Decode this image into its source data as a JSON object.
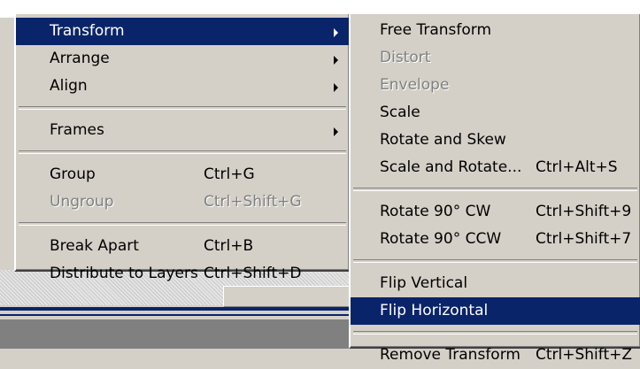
{
  "main_menu": {
    "items": [
      {
        "label": "Transform",
        "shortcut": "",
        "submenu": true,
        "highlighted": true,
        "disabled": false
      },
      {
        "label": "Arrange",
        "shortcut": "",
        "submenu": true,
        "highlighted": false,
        "disabled": false
      },
      {
        "label": "Align",
        "shortcut": "",
        "submenu": true,
        "highlighted": false,
        "disabled": false
      },
      {
        "label": "Frames",
        "shortcut": "",
        "submenu": true,
        "highlighted": false,
        "disabled": false
      },
      {
        "label": "Group",
        "shortcut": "Ctrl+G",
        "submenu": false,
        "highlighted": false,
        "disabled": false
      },
      {
        "label": "Ungroup",
        "shortcut": "Ctrl+Shift+G",
        "submenu": false,
        "highlighted": false,
        "disabled": true
      },
      {
        "label": "Break Apart",
        "shortcut": "Ctrl+B",
        "submenu": false,
        "highlighted": false,
        "disabled": false
      },
      {
        "label": "Distribute to Layers",
        "shortcut": "Ctrl+Shift+D",
        "submenu": false,
        "highlighted": false,
        "disabled": false
      }
    ]
  },
  "transform_submenu": {
    "items": [
      {
        "label": "Free Transform",
        "shortcut": "",
        "disabled": false,
        "highlighted": false
      },
      {
        "label": "Distort",
        "shortcut": "",
        "disabled": true,
        "highlighted": false
      },
      {
        "label": "Envelope",
        "shortcut": "",
        "disabled": true,
        "highlighted": false
      },
      {
        "label": "Scale",
        "shortcut": "",
        "disabled": false,
        "highlighted": false
      },
      {
        "label": "Rotate and Skew",
        "shortcut": "",
        "disabled": false,
        "highlighted": false
      },
      {
        "label": "Scale and Rotate...",
        "shortcut": "Ctrl+Alt+S",
        "disabled": false,
        "highlighted": false
      },
      {
        "label": "Rotate 90° CW",
        "shortcut": "Ctrl+Shift+9",
        "disabled": false,
        "highlighted": false
      },
      {
        "label": "Rotate 90° CCW",
        "shortcut": "Ctrl+Shift+7",
        "disabled": false,
        "highlighted": false
      },
      {
        "label": "Flip Vertical",
        "shortcut": "",
        "disabled": false,
        "highlighted": false
      },
      {
        "label": "Flip Horizontal",
        "shortcut": "",
        "disabled": false,
        "highlighted": true
      },
      {
        "label": "Remove Transform",
        "shortcut": "Ctrl+Shift+Z",
        "disabled": false,
        "highlighted": false
      }
    ]
  },
  "colors": {
    "menu_face": "#d4d0c8",
    "highlight": "#0a246a",
    "highlight_text": "#ffffff",
    "disabled_text": "#808080"
  }
}
